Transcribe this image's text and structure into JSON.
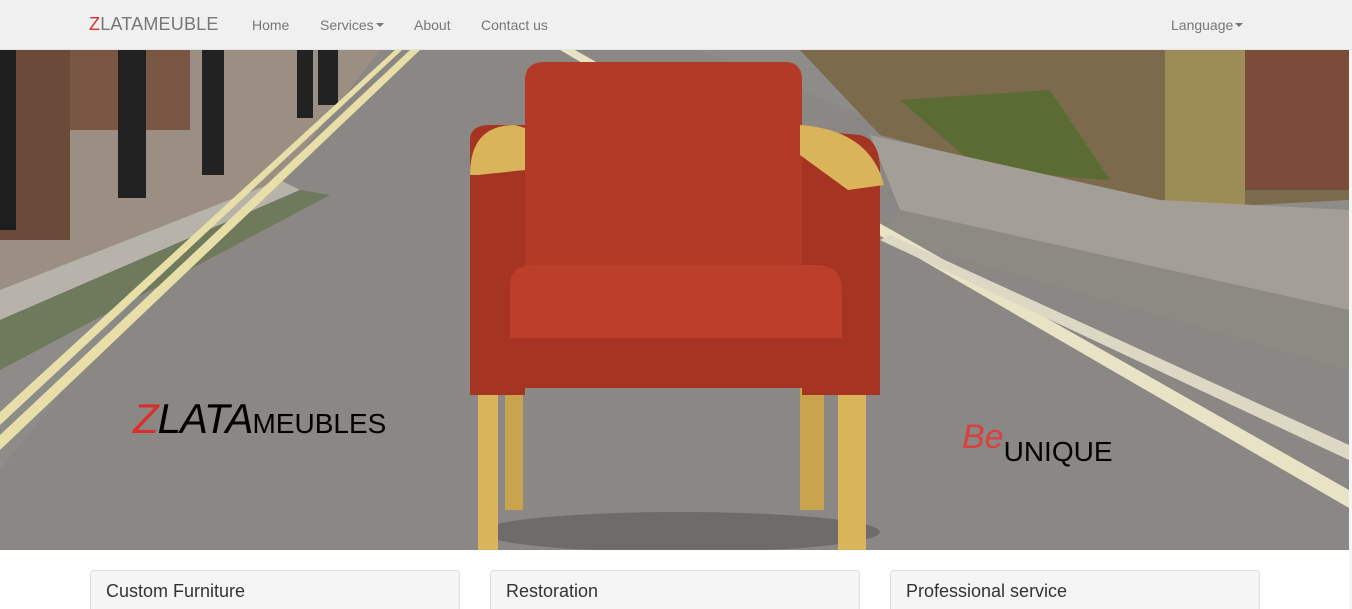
{
  "navbar": {
    "brand_first_letter": "Z",
    "brand_rest": "LATAMEUBLE",
    "links": [
      {
        "label": "Home"
      },
      {
        "label": "Services"
      },
      {
        "label": "About"
      },
      {
        "label": "Contact us"
      }
    ],
    "language_label": "Language"
  },
  "hero": {
    "brand_first_letter": "Z",
    "brand_italic_rest": "LATA",
    "brand_suffix": "MEUBLES",
    "tagline_be": "Be",
    "tagline_unique": "UNIQUE"
  },
  "panels": [
    {
      "title": "Custom Furniture"
    },
    {
      "title": "Restoration"
    },
    {
      "title": "Professional service"
    }
  ],
  "colors": {
    "accent_red": "#d9302e",
    "navbar_bg": "#f0f0f0",
    "nav_text": "#777777"
  }
}
